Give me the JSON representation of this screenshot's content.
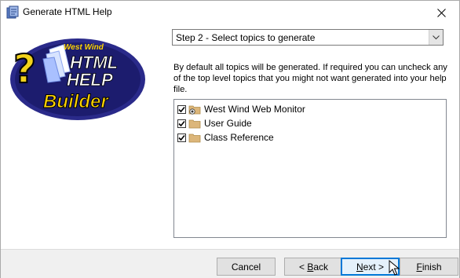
{
  "window": {
    "title": "Generate HTML Help"
  },
  "logo": {
    "line1": "West Wind",
    "line2": "HTML",
    "line3": "HELP",
    "line4": "Builder",
    "question_mark": "?"
  },
  "step_select": {
    "value": "Step 2 - Select topics to generate"
  },
  "description": "By default all topics will be generated. If required you can uncheck any of the top level topics that you might not want generated into your help file.",
  "topics": [
    {
      "label": "West Wind Web Monitor",
      "checked": true,
      "icon": "folder-gear-icon"
    },
    {
      "label": "User Guide",
      "checked": true,
      "icon": "folder-icon"
    },
    {
      "label": "Class Reference",
      "checked": true,
      "icon": "folder-icon"
    }
  ],
  "buttons": {
    "cancel": "Cancel",
    "back_prefix": "< ",
    "back_key": "B",
    "back_rest": "ack",
    "next_key": "N",
    "next_rest": "ext >",
    "finish_key": "F",
    "finish_rest": "inish"
  },
  "colors": {
    "accent": "#0078d7",
    "folder": "#dcb67a"
  }
}
